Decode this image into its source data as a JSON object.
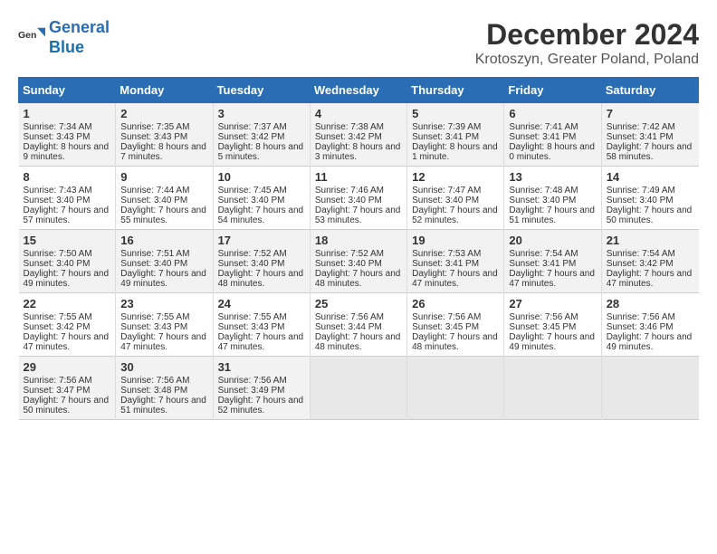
{
  "logo": {
    "line1": "General",
    "line2": "Blue"
  },
  "title": "December 2024",
  "location": "Krotoszyn, Greater Poland, Poland",
  "weekdays": [
    "Sunday",
    "Monday",
    "Tuesday",
    "Wednesday",
    "Thursday",
    "Friday",
    "Saturday"
  ],
  "weeks": [
    [
      {
        "day": "1",
        "sunrise": "Sunrise: 7:34 AM",
        "sunset": "Sunset: 3:43 PM",
        "daylight": "Daylight: 8 hours and 9 minutes."
      },
      {
        "day": "2",
        "sunrise": "Sunrise: 7:35 AM",
        "sunset": "Sunset: 3:43 PM",
        "daylight": "Daylight: 8 hours and 7 minutes."
      },
      {
        "day": "3",
        "sunrise": "Sunrise: 7:37 AM",
        "sunset": "Sunset: 3:42 PM",
        "daylight": "Daylight: 8 hours and 5 minutes."
      },
      {
        "day": "4",
        "sunrise": "Sunrise: 7:38 AM",
        "sunset": "Sunset: 3:42 PM",
        "daylight": "Daylight: 8 hours and 3 minutes."
      },
      {
        "day": "5",
        "sunrise": "Sunrise: 7:39 AM",
        "sunset": "Sunset: 3:41 PM",
        "daylight": "Daylight: 8 hours and 1 minute."
      },
      {
        "day": "6",
        "sunrise": "Sunrise: 7:41 AM",
        "sunset": "Sunset: 3:41 PM",
        "daylight": "Daylight: 8 hours and 0 minutes."
      },
      {
        "day": "7",
        "sunrise": "Sunrise: 7:42 AM",
        "sunset": "Sunset: 3:41 PM",
        "daylight": "Daylight: 7 hours and 58 minutes."
      }
    ],
    [
      {
        "day": "8",
        "sunrise": "Sunrise: 7:43 AM",
        "sunset": "Sunset: 3:40 PM",
        "daylight": "Daylight: 7 hours and 57 minutes."
      },
      {
        "day": "9",
        "sunrise": "Sunrise: 7:44 AM",
        "sunset": "Sunset: 3:40 PM",
        "daylight": "Daylight: 7 hours and 55 minutes."
      },
      {
        "day": "10",
        "sunrise": "Sunrise: 7:45 AM",
        "sunset": "Sunset: 3:40 PM",
        "daylight": "Daylight: 7 hours and 54 minutes."
      },
      {
        "day": "11",
        "sunrise": "Sunrise: 7:46 AM",
        "sunset": "Sunset: 3:40 PM",
        "daylight": "Daylight: 7 hours and 53 minutes."
      },
      {
        "day": "12",
        "sunrise": "Sunrise: 7:47 AM",
        "sunset": "Sunset: 3:40 PM",
        "daylight": "Daylight: 7 hours and 52 minutes."
      },
      {
        "day": "13",
        "sunrise": "Sunrise: 7:48 AM",
        "sunset": "Sunset: 3:40 PM",
        "daylight": "Daylight: 7 hours and 51 minutes."
      },
      {
        "day": "14",
        "sunrise": "Sunrise: 7:49 AM",
        "sunset": "Sunset: 3:40 PM",
        "daylight": "Daylight: 7 hours and 50 minutes."
      }
    ],
    [
      {
        "day": "15",
        "sunrise": "Sunrise: 7:50 AM",
        "sunset": "Sunset: 3:40 PM",
        "daylight": "Daylight: 7 hours and 49 minutes."
      },
      {
        "day": "16",
        "sunrise": "Sunrise: 7:51 AM",
        "sunset": "Sunset: 3:40 PM",
        "daylight": "Daylight: 7 hours and 49 minutes."
      },
      {
        "day": "17",
        "sunrise": "Sunrise: 7:52 AM",
        "sunset": "Sunset: 3:40 PM",
        "daylight": "Daylight: 7 hours and 48 minutes."
      },
      {
        "day": "18",
        "sunrise": "Sunrise: 7:52 AM",
        "sunset": "Sunset: 3:40 PM",
        "daylight": "Daylight: 7 hours and 48 minutes."
      },
      {
        "day": "19",
        "sunrise": "Sunrise: 7:53 AM",
        "sunset": "Sunset: 3:41 PM",
        "daylight": "Daylight: 7 hours and 47 minutes."
      },
      {
        "day": "20",
        "sunrise": "Sunrise: 7:54 AM",
        "sunset": "Sunset: 3:41 PM",
        "daylight": "Daylight: 7 hours and 47 minutes."
      },
      {
        "day": "21",
        "sunrise": "Sunrise: 7:54 AM",
        "sunset": "Sunset: 3:42 PM",
        "daylight": "Daylight: 7 hours and 47 minutes."
      }
    ],
    [
      {
        "day": "22",
        "sunrise": "Sunrise: 7:55 AM",
        "sunset": "Sunset: 3:42 PM",
        "daylight": "Daylight: 7 hours and 47 minutes."
      },
      {
        "day": "23",
        "sunrise": "Sunrise: 7:55 AM",
        "sunset": "Sunset: 3:43 PM",
        "daylight": "Daylight: 7 hours and 47 minutes."
      },
      {
        "day": "24",
        "sunrise": "Sunrise: 7:55 AM",
        "sunset": "Sunset: 3:43 PM",
        "daylight": "Daylight: 7 hours and 47 minutes."
      },
      {
        "day": "25",
        "sunrise": "Sunrise: 7:56 AM",
        "sunset": "Sunset: 3:44 PM",
        "daylight": "Daylight: 7 hours and 48 minutes."
      },
      {
        "day": "26",
        "sunrise": "Sunrise: 7:56 AM",
        "sunset": "Sunset: 3:45 PM",
        "daylight": "Daylight: 7 hours and 48 minutes."
      },
      {
        "day": "27",
        "sunrise": "Sunrise: 7:56 AM",
        "sunset": "Sunset: 3:45 PM",
        "daylight": "Daylight: 7 hours and 49 minutes."
      },
      {
        "day": "28",
        "sunrise": "Sunrise: 7:56 AM",
        "sunset": "Sunset: 3:46 PM",
        "daylight": "Daylight: 7 hours and 49 minutes."
      }
    ],
    [
      {
        "day": "29",
        "sunrise": "Sunrise: 7:56 AM",
        "sunset": "Sunset: 3:47 PM",
        "daylight": "Daylight: 7 hours and 50 minutes."
      },
      {
        "day": "30",
        "sunrise": "Sunrise: 7:56 AM",
        "sunset": "Sunset: 3:48 PM",
        "daylight": "Daylight: 7 hours and 51 minutes."
      },
      {
        "day": "31",
        "sunrise": "Sunrise: 7:56 AM",
        "sunset": "Sunset: 3:49 PM",
        "daylight": "Daylight: 7 hours and 52 minutes."
      },
      null,
      null,
      null,
      null
    ]
  ]
}
